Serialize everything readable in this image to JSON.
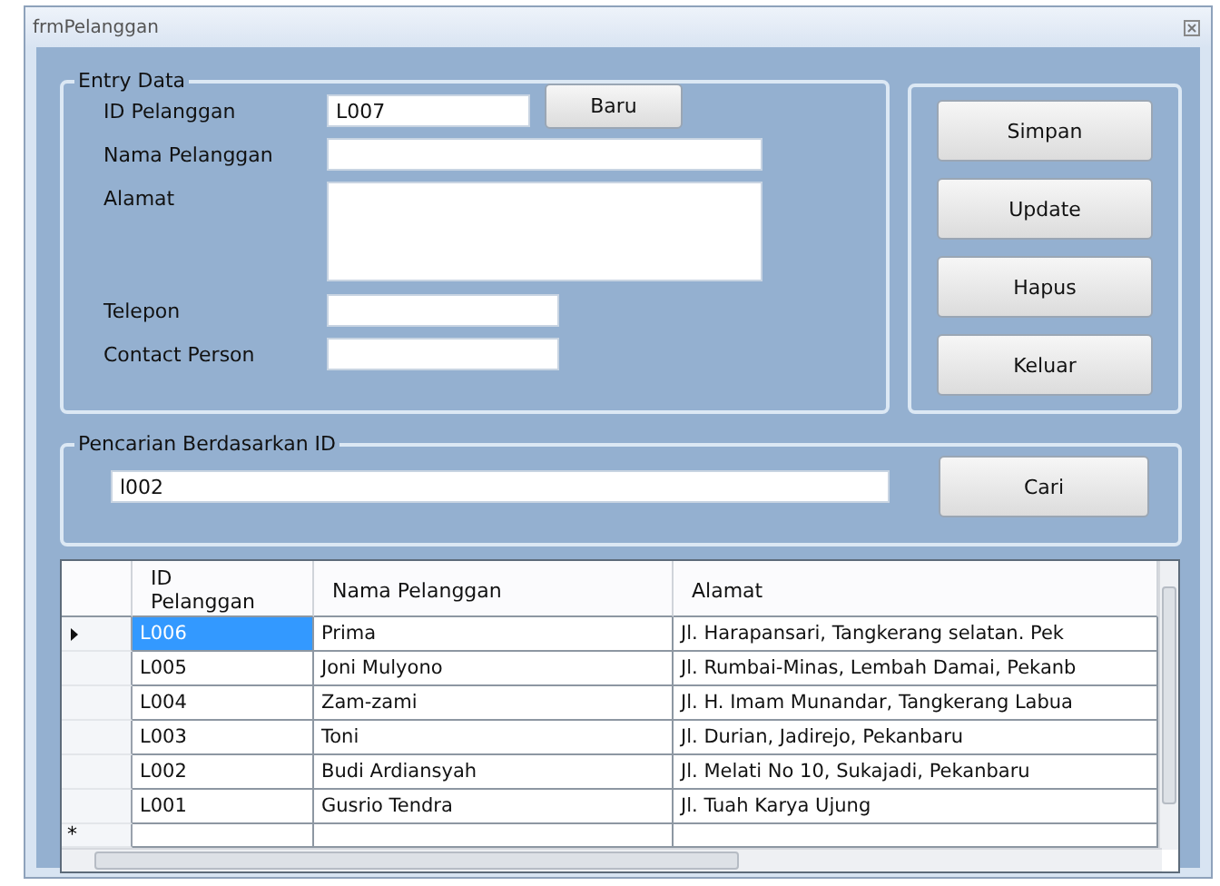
{
  "window": {
    "title": "frmPelanggan"
  },
  "entry": {
    "title": "Entry Data",
    "new_button": "Baru",
    "fields": [
      {
        "label": "ID Pelanggan",
        "value": "L007",
        "kind": "id"
      },
      {
        "label": "Nama Pelanggan",
        "kind": "wide"
      },
      {
        "label": "Alamat",
        "kind": "multiline"
      },
      {
        "label": "Telepon",
        "kind": "short"
      },
      {
        "label": "Contact Person",
        "kind": "short"
      }
    ]
  },
  "actions": [
    "Simpan",
    "Update",
    "Hapus",
    "Keluar"
  ],
  "search": {
    "title": "Pencarian Berdasarkan ID",
    "value": "l002",
    "button": "Cari"
  },
  "table": {
    "columns": [
      "ID Pelanggan",
      "Nama Pelanggan",
      "Alamat"
    ],
    "rows": [
      {
        "cells": [
          "L006",
          "Prima",
          "Jl. Harapansari, Tangkerang selatan. Pek"
        ],
        "selected": true
      },
      {
        "cells": [
          "L005",
          "Joni Mulyono",
          "Jl. Rumbai-Minas, Lembah Damai, Pekanb"
        ],
        "selected": false
      },
      {
        "cells": [
          "L004",
          "Zam-zami",
          "Jl. H. Imam Munandar, Tangkerang Labua"
        ],
        "selected": false
      },
      {
        "cells": [
          "L003",
          "Toni",
          "Jl. Durian, Jadirejo, Pekanbaru"
        ],
        "selected": false
      },
      {
        "cells": [
          "L002",
          "Budi Ardiansyah",
          "Jl. Melati No 10, Sukajadi, Pekanbaru"
        ],
        "selected": false
      },
      {
        "cells": [
          "L001",
          "Gusrio Tendra",
          "Jl. Tuah Karya Ujung"
        ],
        "selected": false
      }
    ],
    "new_row_marker": "*"
  }
}
